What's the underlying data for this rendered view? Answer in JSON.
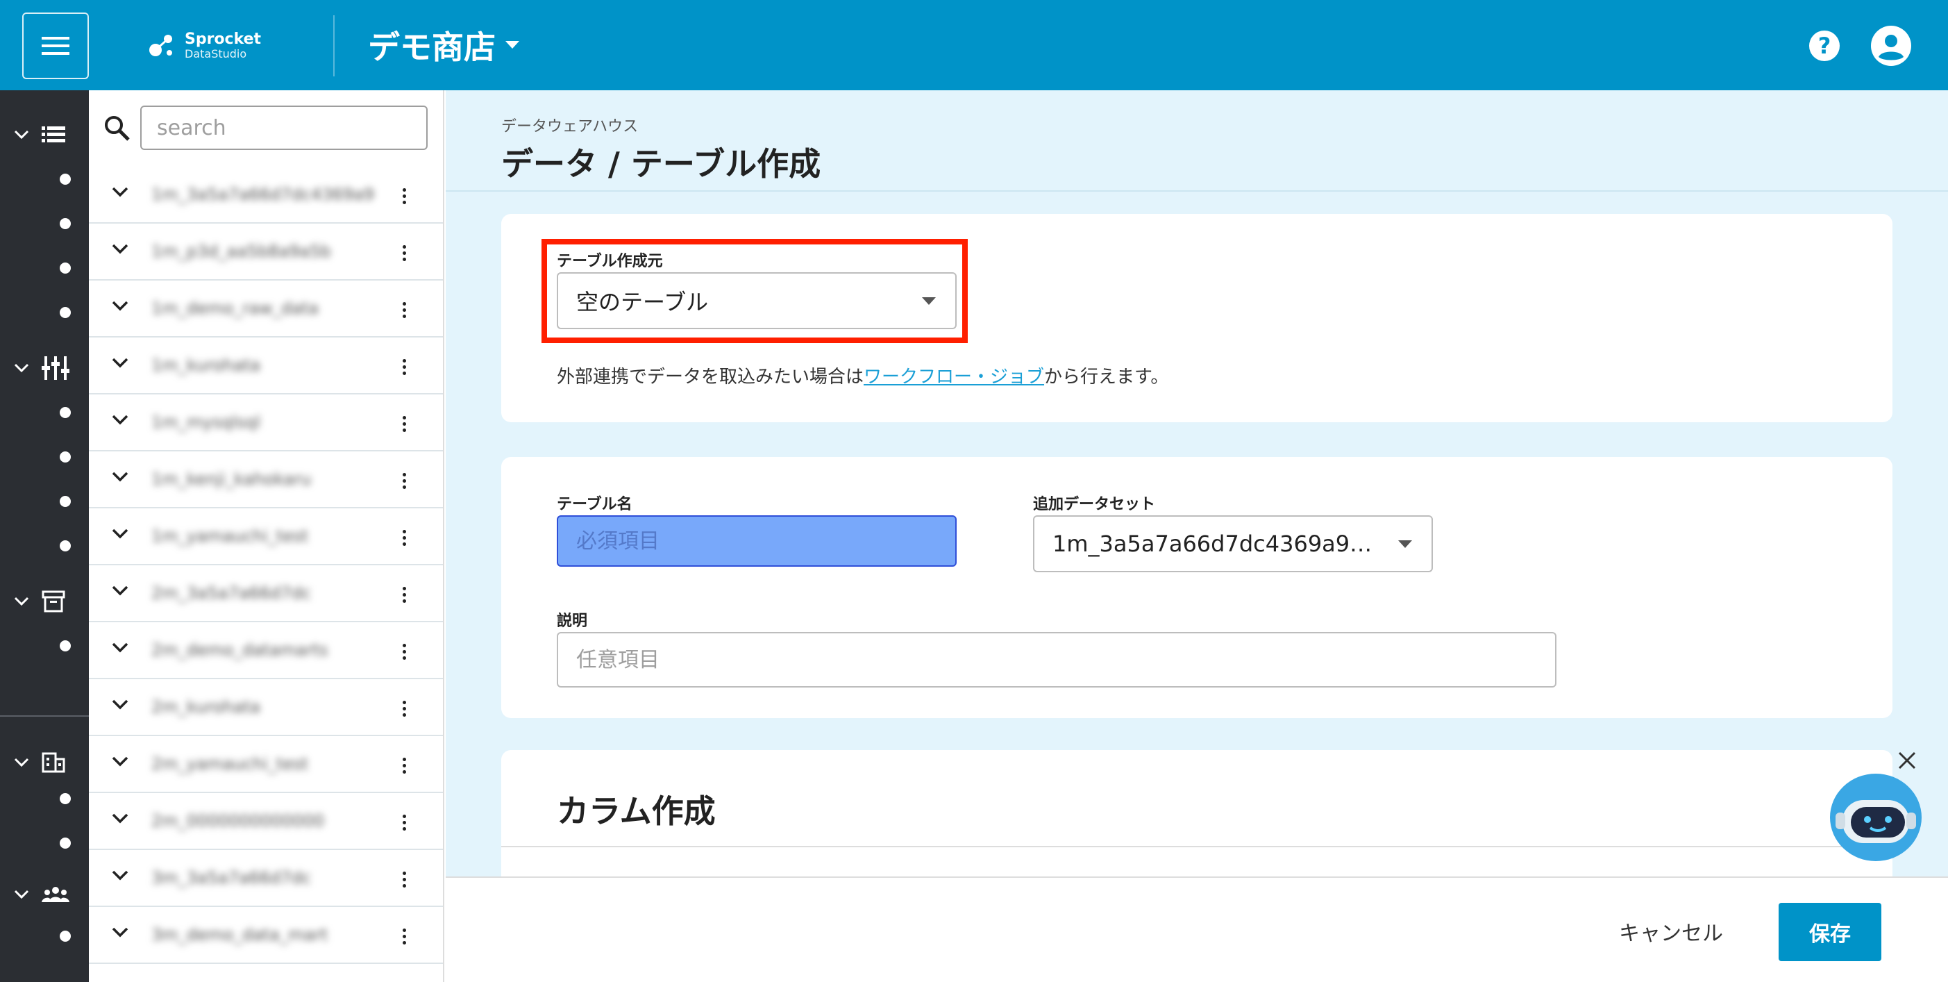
{
  "header": {
    "logo_name": "Sprocket",
    "logo_sub": "DataStudio",
    "store_name": "デモ商店",
    "help_symbol": "?",
    "colors": {
      "brand": "#0093c8"
    }
  },
  "leftnav": {
    "sections": [
      {
        "icon": "database-list-icon",
        "dots": 4
      },
      {
        "icon": "pipeline-icon",
        "dots": 4
      },
      {
        "icon": "archive-icon",
        "dots": 1
      },
      {
        "icon": "building-icon",
        "dots": 2
      },
      {
        "icon": "people-icon",
        "dots": 1
      }
    ]
  },
  "sidebar": {
    "search_placeholder": "search",
    "items": [
      {
        "label": "1m_3a5a7a66d7dc4369a9"
      },
      {
        "label": "1m_p3d_aa5b8a9a5b"
      },
      {
        "label": "1m_demo_raw_data"
      },
      {
        "label": "1m_kurohata"
      },
      {
        "label": "1m_mysqlsql"
      },
      {
        "label": "1m_kenji_kahokaru"
      },
      {
        "label": "1m_yamauchi_test"
      },
      {
        "label": "2m_3a5a7a66d7dc"
      },
      {
        "label": "2m_demo_datamarts"
      },
      {
        "label": "2m_kurohata"
      },
      {
        "label": "2m_yamauchi_test"
      },
      {
        "label": "2m_0000000000000"
      },
      {
        "label": "3m_3a5a7a66d7dc"
      },
      {
        "label": "3m_demo_data_mart"
      }
    ]
  },
  "main": {
    "breadcrumb": "データウェアハウス",
    "title": "データ / テーブル作成",
    "source": {
      "label": "テーブル作成元",
      "value": "空のテーブル",
      "hint_before": "外部連携でデータを取込みたい場合は",
      "hint_link": "ワークフロー・ジョブ",
      "hint_after": "から行えます。"
    },
    "table_form": {
      "name_label": "テーブル名",
      "name_placeholder": "必須項目",
      "dataset_label": "追加データセット",
      "dataset_value": "1m_3a5a7a66d7dc4369a9…",
      "desc_label": "説明",
      "desc_placeholder": "任意項目"
    },
    "columns": {
      "title": "カラム作成"
    }
  },
  "footer": {
    "cancel_label": "キャンセル",
    "save_label": "保存"
  }
}
